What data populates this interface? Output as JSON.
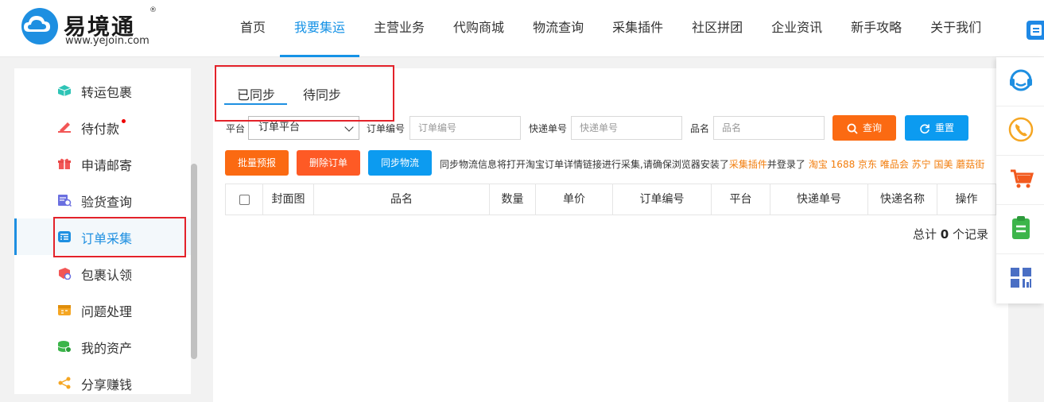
{
  "header": {
    "logo": {
      "name": "易境通",
      "reg": "®",
      "url": "www.yejoin.com"
    },
    "nav": [
      {
        "label": "首页",
        "active": false
      },
      {
        "label": "我要集运",
        "active": true
      },
      {
        "label": "主营业务",
        "active": false
      },
      {
        "label": "代购商城",
        "active": false
      },
      {
        "label": "物流查询",
        "active": false
      },
      {
        "label": "采集插件",
        "active": false
      },
      {
        "label": "社区拼团",
        "active": false
      },
      {
        "label": "企业资讯",
        "active": false
      },
      {
        "label": "新手攻略",
        "active": false
      },
      {
        "label": "关于我们",
        "active": false
      }
    ]
  },
  "sidebar": {
    "items": [
      {
        "label": "转运包裹",
        "icon": "box-icon",
        "color": "#2ec4b6"
      },
      {
        "label": "待付款",
        "icon": "payment-icon",
        "color": "#f25656",
        "dot": true
      },
      {
        "label": "申请邮寄",
        "icon": "gift-icon",
        "color": "#f25656"
      },
      {
        "label": "验货查询",
        "icon": "inspect-icon",
        "color": "#6a6fe0"
      },
      {
        "label": "订单采集",
        "icon": "order-collect-icon",
        "color": "#1e8fe1",
        "active": true
      },
      {
        "label": "包裹认领",
        "icon": "claim-icon",
        "color": "#f25656"
      },
      {
        "label": "问题处理",
        "icon": "calendar-icon",
        "color": "#f5a623"
      },
      {
        "label": "我的资产",
        "icon": "coins-icon",
        "color": "#3cb54a"
      },
      {
        "label": "分享赚钱",
        "icon": "share-icon",
        "color": "#f5a623"
      }
    ]
  },
  "main": {
    "tabs": [
      {
        "label": "已同步",
        "active": true
      },
      {
        "label": "待同步",
        "active": false
      }
    ],
    "filters": {
      "platform_label": "平台",
      "platform_value": "订单平台",
      "order_no_label": "订单编号",
      "order_no_placeholder": "订单编号",
      "express_no_label": "快递单号",
      "express_no_placeholder": "快递单号",
      "product_label": "品名",
      "product_placeholder": "品名",
      "query_button": "查询",
      "reset_button": "重置"
    },
    "actions": {
      "batch_forecast": "批量预报",
      "delete_order": "删除订单",
      "sync_logistics": "同步物流"
    },
    "tip": {
      "text": "同步物流信息将打开淘宝订单详情链接进行采集,请确保浏览器安装了",
      "plugin_link": "采集插件",
      "logged_text": "并登录了",
      "platforms": "淘宝 1688 京东 唯品会 苏宁 国美 蘑菇街"
    },
    "table": {
      "headers": [
        "封面图",
        "品名",
        "数量",
        "单价",
        "订单编号",
        "平台",
        "快递单号",
        "快递名称",
        "操作"
      ]
    },
    "total": {
      "prefix": "总计",
      "count": "0",
      "suffix": "个记录"
    }
  },
  "colors": {
    "primary_blue": "#1e8fe1",
    "orange": "#fb6a12",
    "annotation_red": "#e3222a"
  }
}
